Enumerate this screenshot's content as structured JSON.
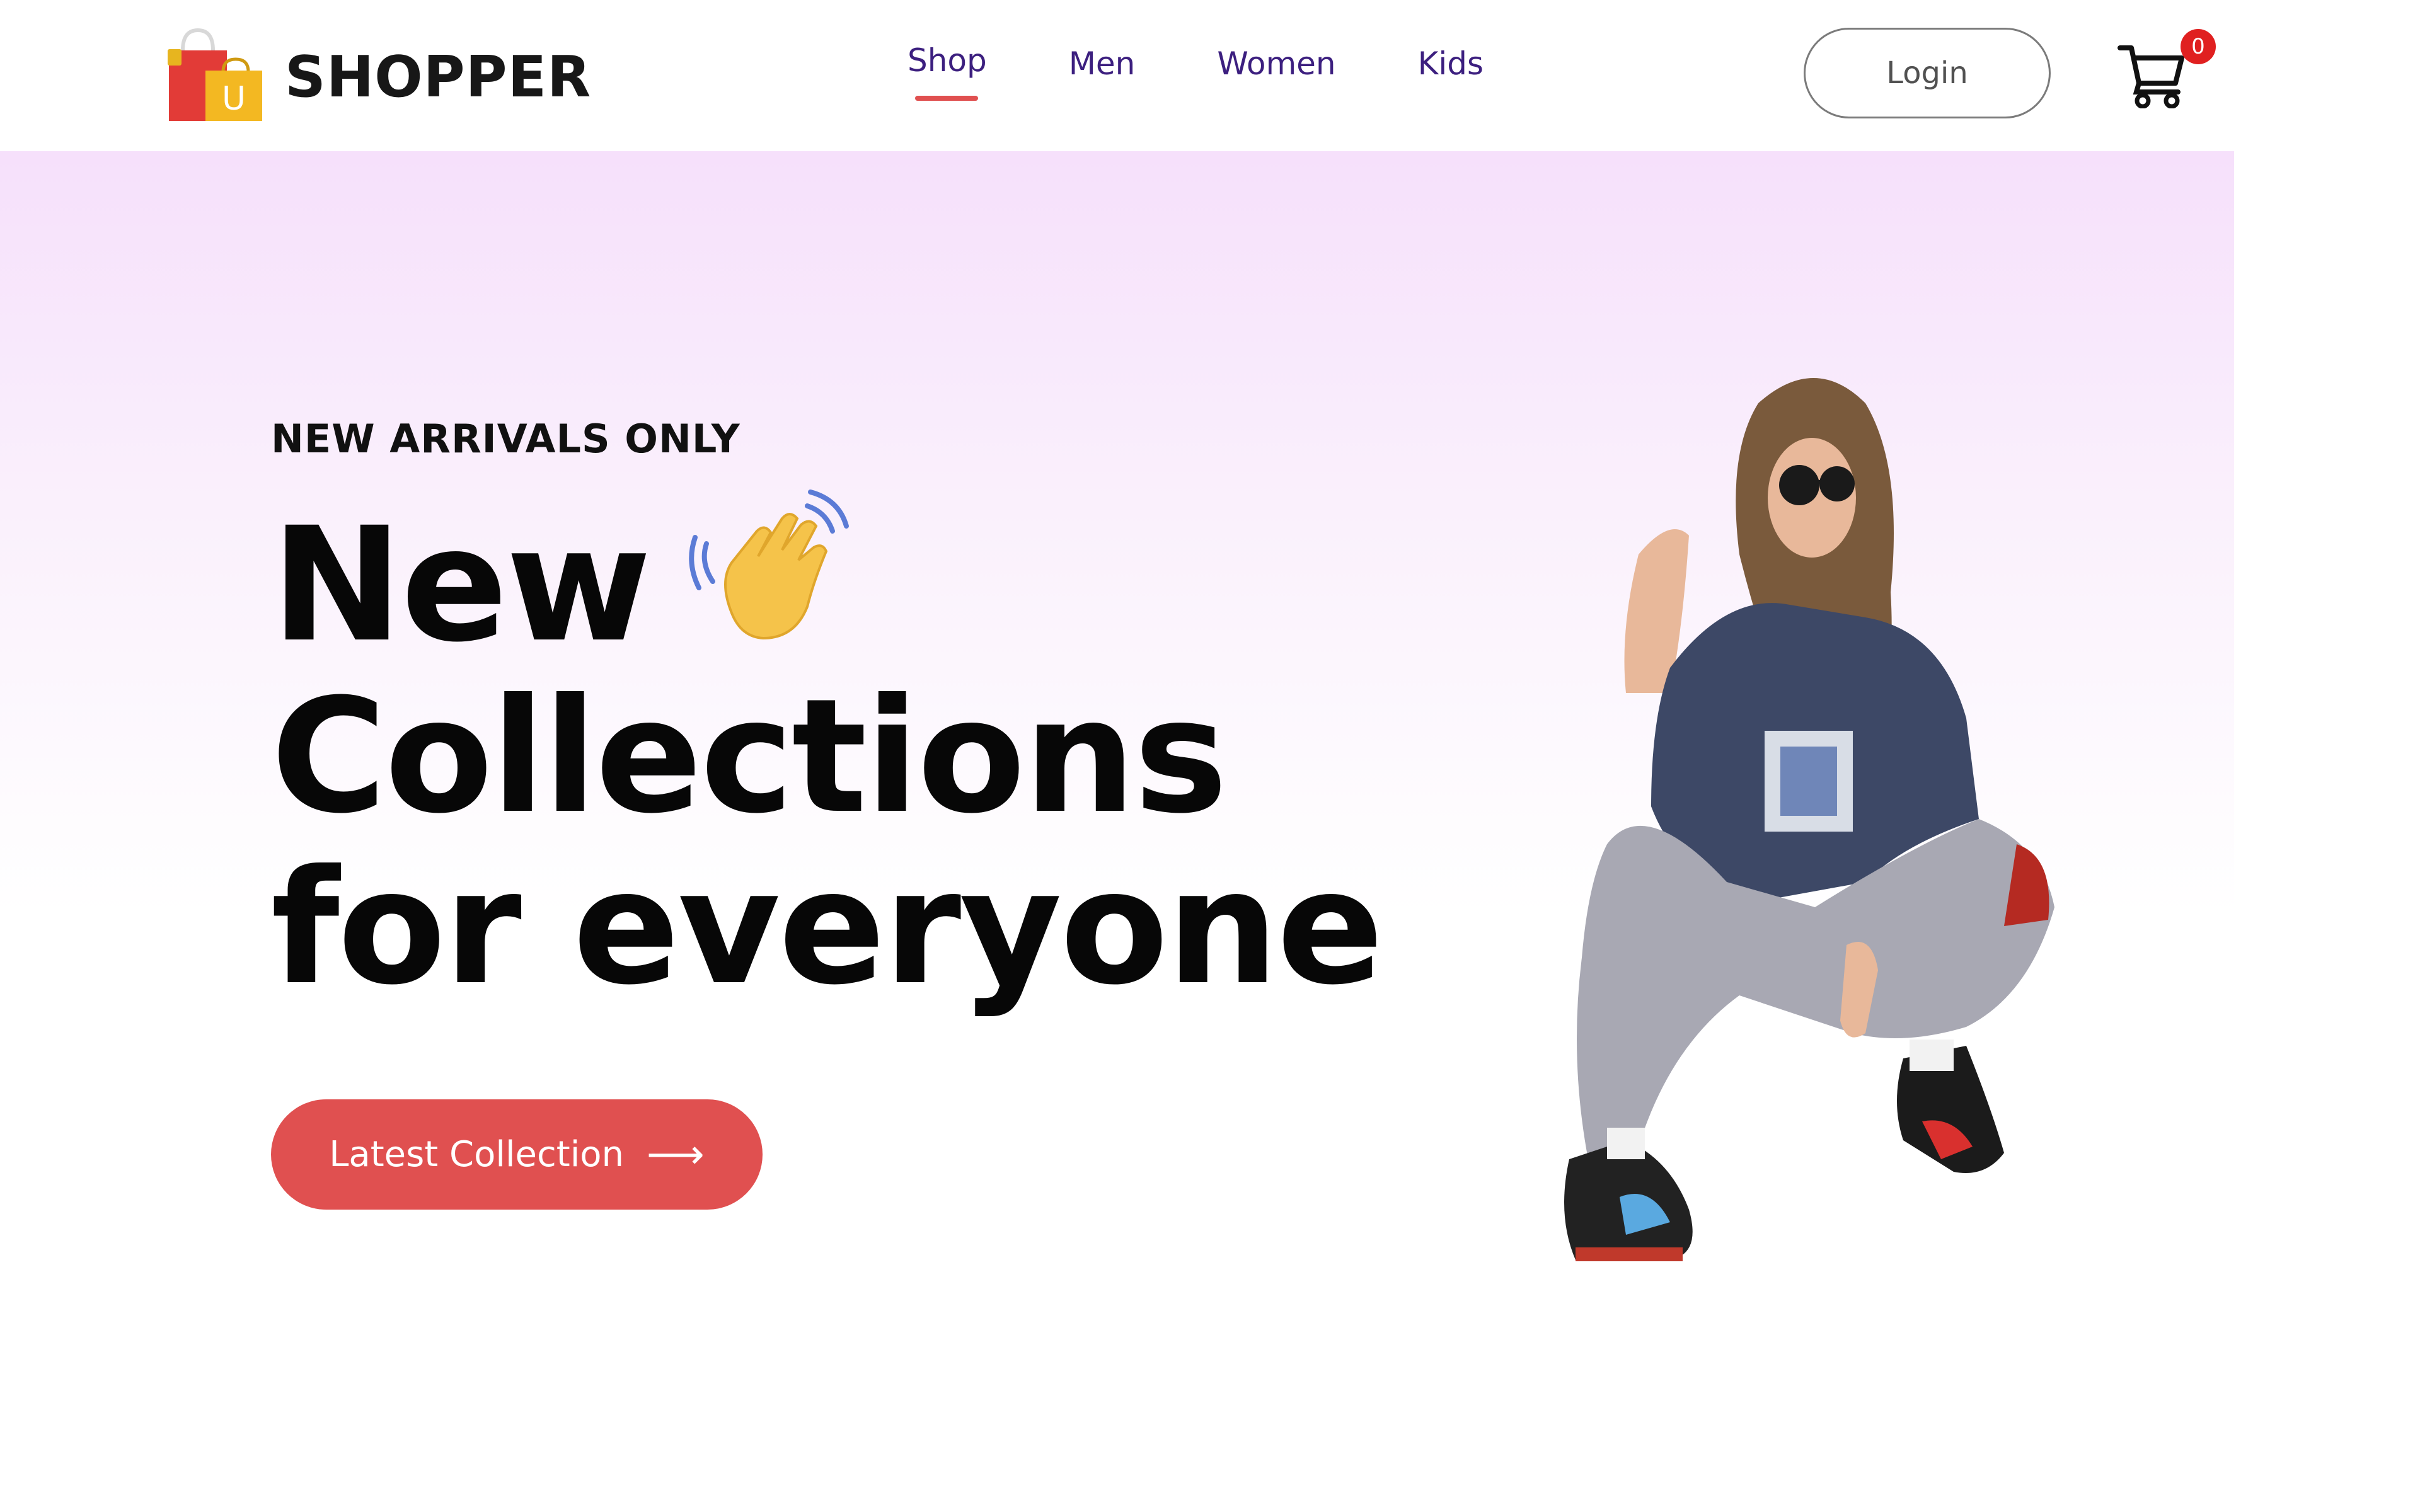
{
  "brand": {
    "name": "SHOPPER",
    "logo_icon": "shopping-bag-icon",
    "logo_letter": "U"
  },
  "nav": {
    "items": [
      {
        "label": "Shop",
        "active": true
      },
      {
        "label": "Men",
        "active": false
      },
      {
        "label": "Women",
        "active": false
      },
      {
        "label": "Kids",
        "active": false
      }
    ]
  },
  "login_label": "Login",
  "cart": {
    "icon": "cart-icon",
    "count": "0"
  },
  "hero": {
    "eyebrow": "NEW ARRIVALS ONLY",
    "headline": [
      "New",
      "Collections",
      "for everyone"
    ],
    "headline_emoji": "waving-hand-icon",
    "cta_label": "Latest Collection",
    "cta_icon": "arrow-right-icon",
    "image": "model-squatting-photo"
  },
  "colors": {
    "accent": "#e05050",
    "nav_text": "#3c1f7f",
    "hero_gradient_top": "#f6e0fb",
    "hero_gradient_bottom": "#ffffff"
  }
}
